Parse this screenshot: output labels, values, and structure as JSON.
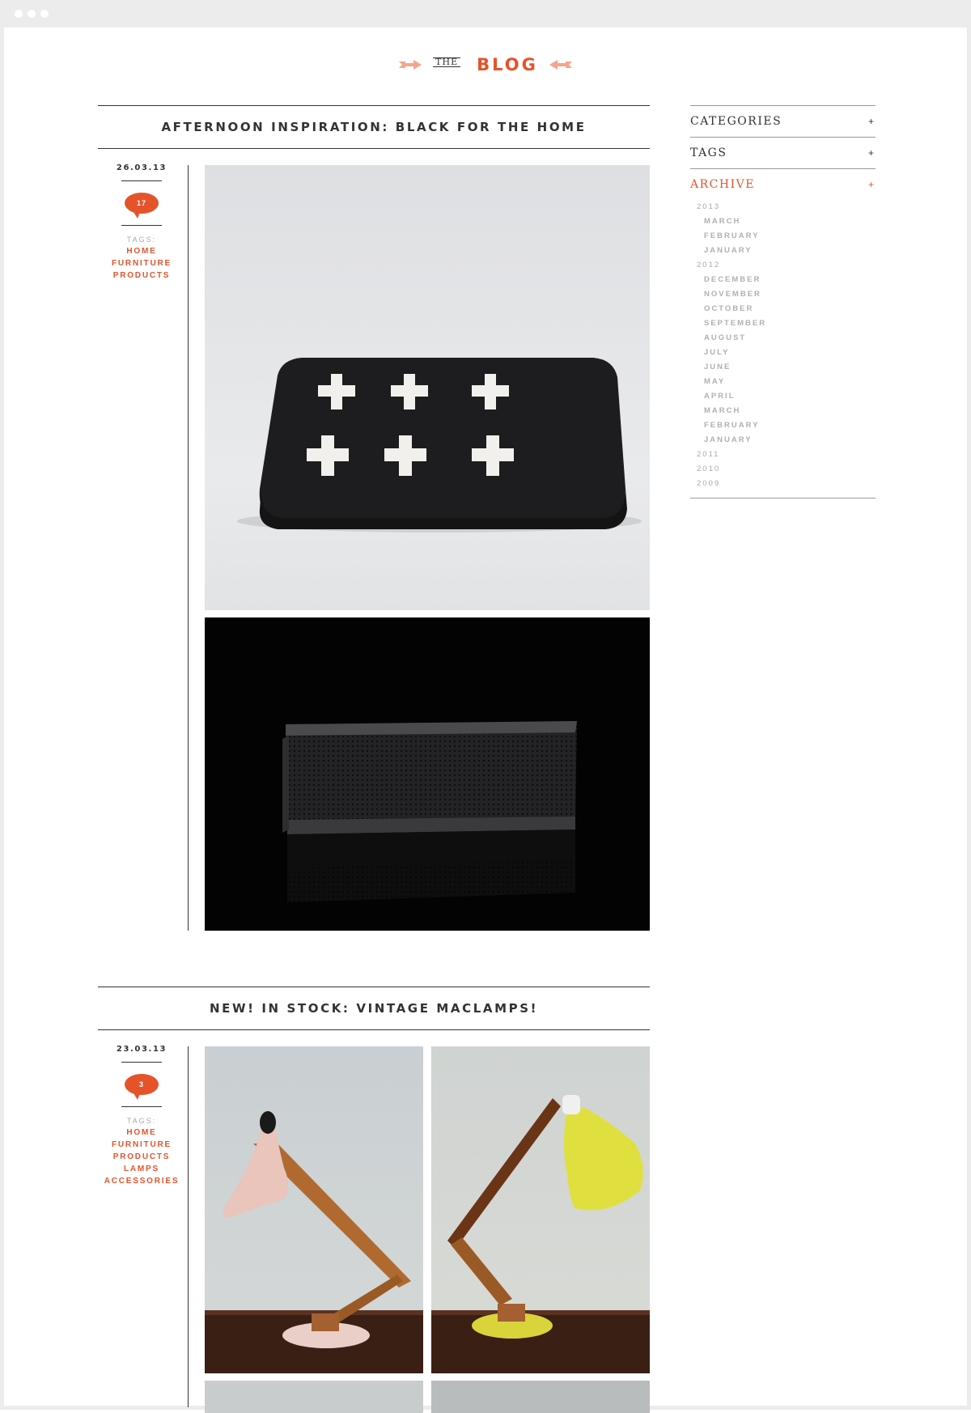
{
  "header": {
    "the": "THE",
    "title": "BLOG"
  },
  "colors": {
    "accent": "#e5532b",
    "text": "#333333",
    "muted": "#aaaaaa"
  },
  "posts": [
    {
      "title": "AFTERNOON INSPIRATION: BLACK FOR THE HOME",
      "date": "26.03.13",
      "comments": "17",
      "tags_label": "TAGS:",
      "tags": [
        "HOME",
        "FURNITURE",
        "PRODUCTS"
      ]
    },
    {
      "title": "NEW! IN STOCK: VINTAGE MACLAMPS!",
      "date": "23.03.13",
      "comments": "3",
      "tags_label": "TAGS:",
      "tags": [
        "HOME",
        "FURNITURE",
        "PRODUCTS",
        "LAMPS",
        "ACCESSORIES"
      ]
    }
  ],
  "sidebar": {
    "categories": "CATEGORIES",
    "tags": "TAGS",
    "archive": "ARCHIVE",
    "plus": "+",
    "archive_items": [
      {
        "label": "2013",
        "kind": "year"
      },
      {
        "label": "MARCH",
        "kind": "month"
      },
      {
        "label": "FEBRUARY",
        "kind": "month"
      },
      {
        "label": "JANUARY",
        "kind": "month"
      },
      {
        "label": "2012",
        "kind": "year"
      },
      {
        "label": "DECEMBER",
        "kind": "month"
      },
      {
        "label": "NOVEMBER",
        "kind": "month"
      },
      {
        "label": "OCTOBER",
        "kind": "month"
      },
      {
        "label": "SEPTEMBER",
        "kind": "month"
      },
      {
        "label": "AUGUST",
        "kind": "month"
      },
      {
        "label": "JULY",
        "kind": "month"
      },
      {
        "label": "JUNE",
        "kind": "month"
      },
      {
        "label": "MAY",
        "kind": "month"
      },
      {
        "label": "APRIL",
        "kind": "month"
      },
      {
        "label": "MARCH",
        "kind": "month"
      },
      {
        "label": "FEBRUARY",
        "kind": "month"
      },
      {
        "label": "JANUARY",
        "kind": "month"
      },
      {
        "label": "2011",
        "kind": "year"
      },
      {
        "label": "2010",
        "kind": "year"
      },
      {
        "label": "2009",
        "kind": "year"
      }
    ]
  }
}
